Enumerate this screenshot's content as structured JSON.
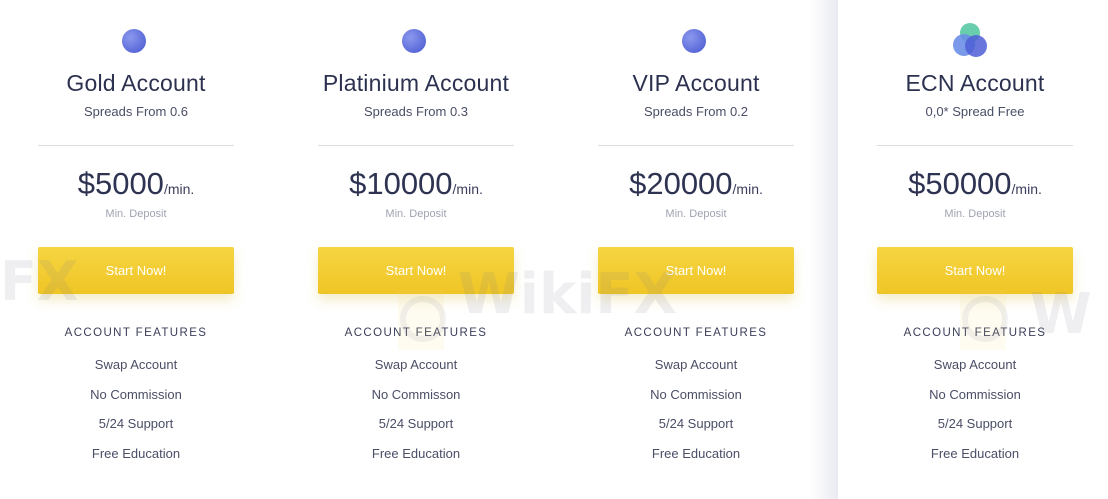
{
  "cta_color": "#f2cb2f",
  "icon_color": "#5c6cd8",
  "plans": [
    {
      "icon": "circle-dot-icon",
      "name": "Gold Account",
      "spread": "Spreads From 0.6",
      "price": "$5000",
      "price_suffix": "/min.",
      "deposit_label": "Min. Deposit",
      "button_label": "Start Now!",
      "features_title": "ACCOUNT FEATURES",
      "features": [
        "Swap Account",
        "No Commission",
        "5/24 Support",
        "Free Education"
      ]
    },
    {
      "icon": "circle-dot-icon",
      "name": "Platinium Account",
      "spread": "Spreads From 0.3",
      "price": "$10000",
      "price_suffix": "/min.",
      "deposit_label": "Min. Deposit",
      "button_label": "Start Now!",
      "features_title": "ACCOUNT FEATURES",
      "features": [
        "Swap Account",
        "No Commisson",
        "5/24 Support",
        "Free Education"
      ]
    },
    {
      "icon": "circle-dot-icon",
      "name": "VIP Account",
      "spread": "Spreads From 0.2",
      "price": "$20000",
      "price_suffix": "/min.",
      "deposit_label": "Min. Deposit",
      "button_label": "Start Now!",
      "features_title": "ACCOUNT FEATURES",
      "features": [
        "Swap Account",
        "No Commission",
        "5/24 Support",
        "Free Education"
      ]
    },
    {
      "icon": "overlapping-circles-icon",
      "name": "ECN Account",
      "spread": "0,0* Spread Free",
      "price": "$50000",
      "price_suffix": "/min.",
      "deposit_label": "Min. Deposit",
      "button_label": "Start Now!",
      "features_title": "ACCOUNT FEATURES",
      "features": [
        "Swap Account",
        "No Commission",
        "5/24 Support",
        "Free Education"
      ]
    }
  ],
  "watermark": {
    "text_left": "FX",
    "text_center": "WikiFX",
    "text_right": "W"
  }
}
